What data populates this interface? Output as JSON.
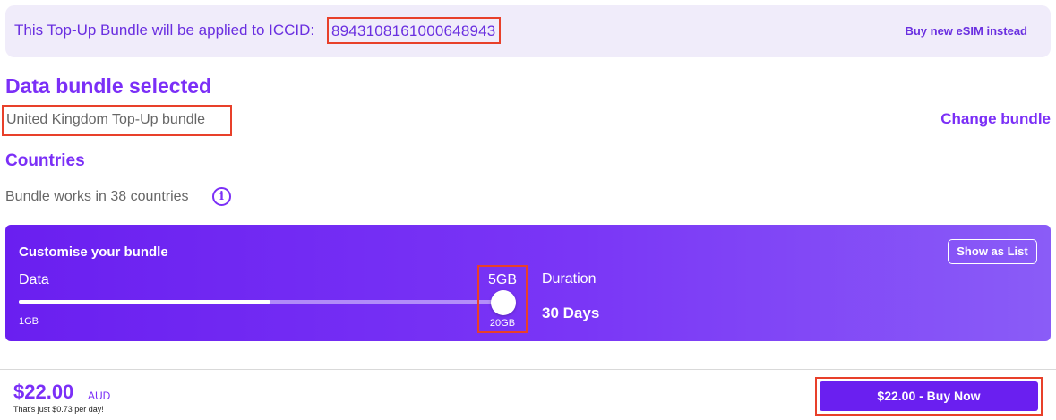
{
  "banner": {
    "text": "This Top-Up Bundle will be applied to ICCID:",
    "iccid": "8943108161000648943",
    "link_label": "Buy new eSIM instead"
  },
  "bundle": {
    "title": "Data bundle selected",
    "name": "United Kingdom Top-Up bundle",
    "change_label": "Change bundle"
  },
  "countries": {
    "title": "Countries",
    "subtitle": "Bundle works in 38 countries",
    "info_icon": "i"
  },
  "customise": {
    "title": "Customise your bundle",
    "show_list_label": "Show as List",
    "data_label": "Data",
    "min_label": "1GB",
    "current_value": "5GB",
    "max_label": "20GB",
    "slider_fraction": 0.52,
    "duration_label": "Duration",
    "duration_value": "30 Days"
  },
  "footer": {
    "price": "$22.00",
    "currency": "AUD",
    "per_day": "That's just $0.73 per day!",
    "buy_label": "$22.00 - Buy Now"
  },
  "colors": {
    "accent": "#7b2ff7",
    "highlight_border": "#e8402a",
    "banner_bg": "#f0ecfa"
  }
}
